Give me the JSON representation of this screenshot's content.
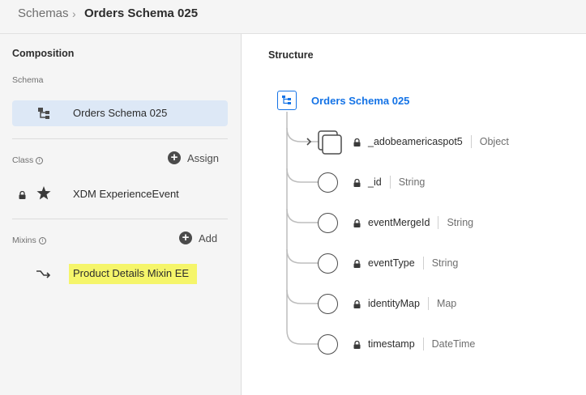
{
  "breadcrumb": {
    "root": "Schemas",
    "current": "Orders Schema 025"
  },
  "composition": {
    "title": "Composition",
    "schema_label": "Schema",
    "schema_name": "Orders Schema 025",
    "class_label": "Class",
    "class_action": "Assign",
    "class_name": "XDM ExperienceEvent",
    "mixins_label": "Mixins",
    "mixins_action": "Add",
    "mixin_name": "Product Details Mixin EE"
  },
  "structure": {
    "title": "Structure",
    "root": "Orders Schema 025",
    "fields": [
      {
        "name": "_adobeamericaspot5",
        "type": "Object",
        "expandable": true
      },
      {
        "name": "_id",
        "type": "String"
      },
      {
        "name": "eventMergeId",
        "type": "String"
      },
      {
        "name": "eventType",
        "type": "String"
      },
      {
        "name": "identityMap",
        "type": "Map"
      },
      {
        "name": "timestamp",
        "type": "DateTime"
      }
    ]
  },
  "colors": {
    "accent": "#1473e6",
    "highlight": "#f5f56a",
    "selected": "#dde8f6"
  }
}
